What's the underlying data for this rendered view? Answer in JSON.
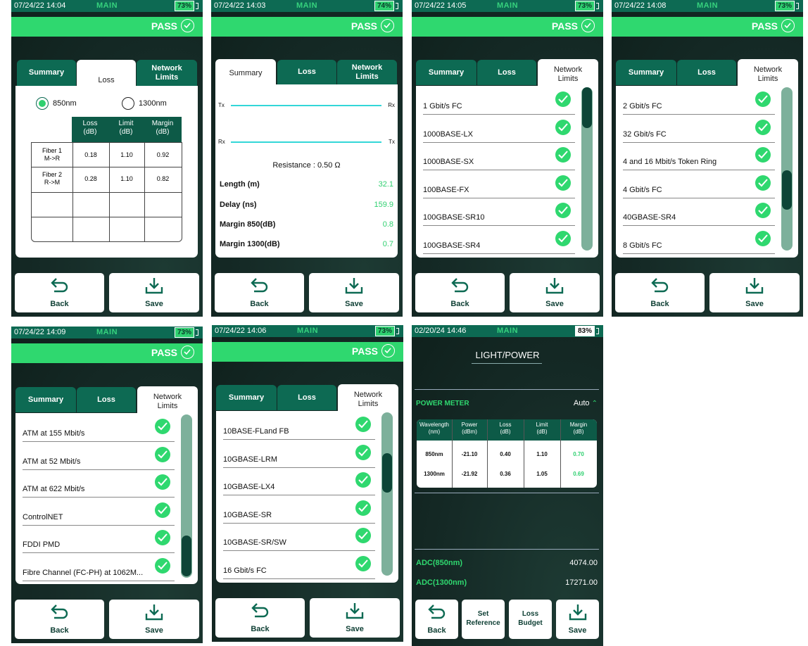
{
  "common": {
    "main_label": "MAIN",
    "pass_label": "PASS",
    "back_label": "Back",
    "save_label": "Save",
    "tab_summary": "Summary",
    "tab_loss": "Loss",
    "tab_network_1": "Network",
    "tab_network_2": "Limits",
    "colors": {
      "dark_green": "#0d6a53",
      "pass_green": "#2fd86f",
      "margin_green": "#2fd070"
    }
  },
  "s1": {
    "time": "07/24/22 14:04",
    "battery": "73%",
    "radio_850": "850nm",
    "radio_1300": "1300nm",
    "headers": [
      "Loss (dB)",
      "Limit (dB)",
      "Margin (dB)"
    ],
    "h_loss_1": "Loss",
    "h_loss_2": "(dB)",
    "h_limit_1": "Limit",
    "h_limit_2": "(dB)",
    "h_margin_1": "Margin",
    "h_margin_2": "(dB)",
    "row1_label_1": "Fiber 1",
    "row1_label_2": "M->R",
    "row1_loss": "0.18",
    "row1_limit": "1.10",
    "row1_margin": "0.92",
    "row2_label_1": "Fiber 2",
    "row2_label_2": "R->M",
    "row2_loss": "0.28",
    "row2_limit": "1.10",
    "row2_margin": "0.82"
  },
  "s2": {
    "time": "07/24/22 14:03",
    "battery": "74%",
    "tx": "Tx",
    "rx": "Rx",
    "resistance": "Resistance : 0.50 Ω",
    "length_label": "Length (m)",
    "length_value": "32.1",
    "delay_label": "Delay (ns)",
    "delay_value": "159.9",
    "m850_label": "Margin 850(dB)",
    "m850_value": "0.8",
    "m1300_label": "Margin 1300(dB)",
    "m1300_value": "0.7"
  },
  "s3": {
    "time": "07/24/22 14:05",
    "battery": "73%",
    "items": [
      "1 Gbit/s FC",
      "1000BASE-LX",
      "1000BASE-SX",
      "100BASE-FX",
      "100GBASE-SR10",
      "100GBASE-SR4"
    ]
  },
  "s4": {
    "time": "07/24/22 14:08",
    "battery": "73%",
    "items": [
      "2 Gbit/s FC",
      "32 Gbit/s FC",
      "4 and 16 Mbit/s Token Ring",
      "4 Gbit/s FC",
      "40GBASE-SR4",
      "8 Gbit/s FC"
    ]
  },
  "s5": {
    "time": "07/24/22 14:09",
    "battery": "73%",
    "items": [
      "ATM at 155 Mbit/s",
      "ATM at 52 Mbit/s",
      "ATM at 622 Mbit/s",
      "ControlNET",
      "FDDI PMD",
      "Fibre Channel (FC-PH) at 1062M..."
    ]
  },
  "s6": {
    "time": "07/24/22 14:06",
    "battery": "73%",
    "items": [
      "10BASE-FLand FB",
      "10GBASE-LRM",
      "10GBASE-LX4",
      "10GBASE-SR",
      "10GBASE-SR/SW",
      "16 Gbit/s FC"
    ]
  },
  "s7": {
    "time": "02/20/24 14:46",
    "battery": "83%",
    "title": "LIGHT/POWER",
    "power_meter": "POWER METER",
    "auto": "Auto",
    "h_wl_1": "Wavelength",
    "h_wl_2": "(nm)",
    "h_pw_1": "Power",
    "h_pw_2": "(dBm)",
    "h_loss_1": "Loss",
    "h_loss_2": "(dB)",
    "h_limit_1": "Limit",
    "h_limit_2": "(dB)",
    "h_margin_1": "Margin",
    "h_margin_2": "(dB)",
    "r1_wl": "850nm",
    "r1_pw": "-21.10",
    "r1_loss": "0.40",
    "r1_limit": "1.10",
    "r1_margin": "0.70",
    "r2_wl": "1300nm",
    "r2_pw": "-21.92",
    "r2_loss": "0.36",
    "r2_limit": "1.05",
    "r2_margin": "0.69",
    "adc850_label": "ADC(850nm)",
    "adc850_value": "4074.00",
    "adc1300_label": "ADC(1300nm)",
    "adc1300_value": "17271.00",
    "btn_back": "Back",
    "btn_setref_1": "Set",
    "btn_setref_2": "Reference",
    "btn_budget_1": "Loss",
    "btn_budget_2": "Budget",
    "btn_save": "Save"
  }
}
